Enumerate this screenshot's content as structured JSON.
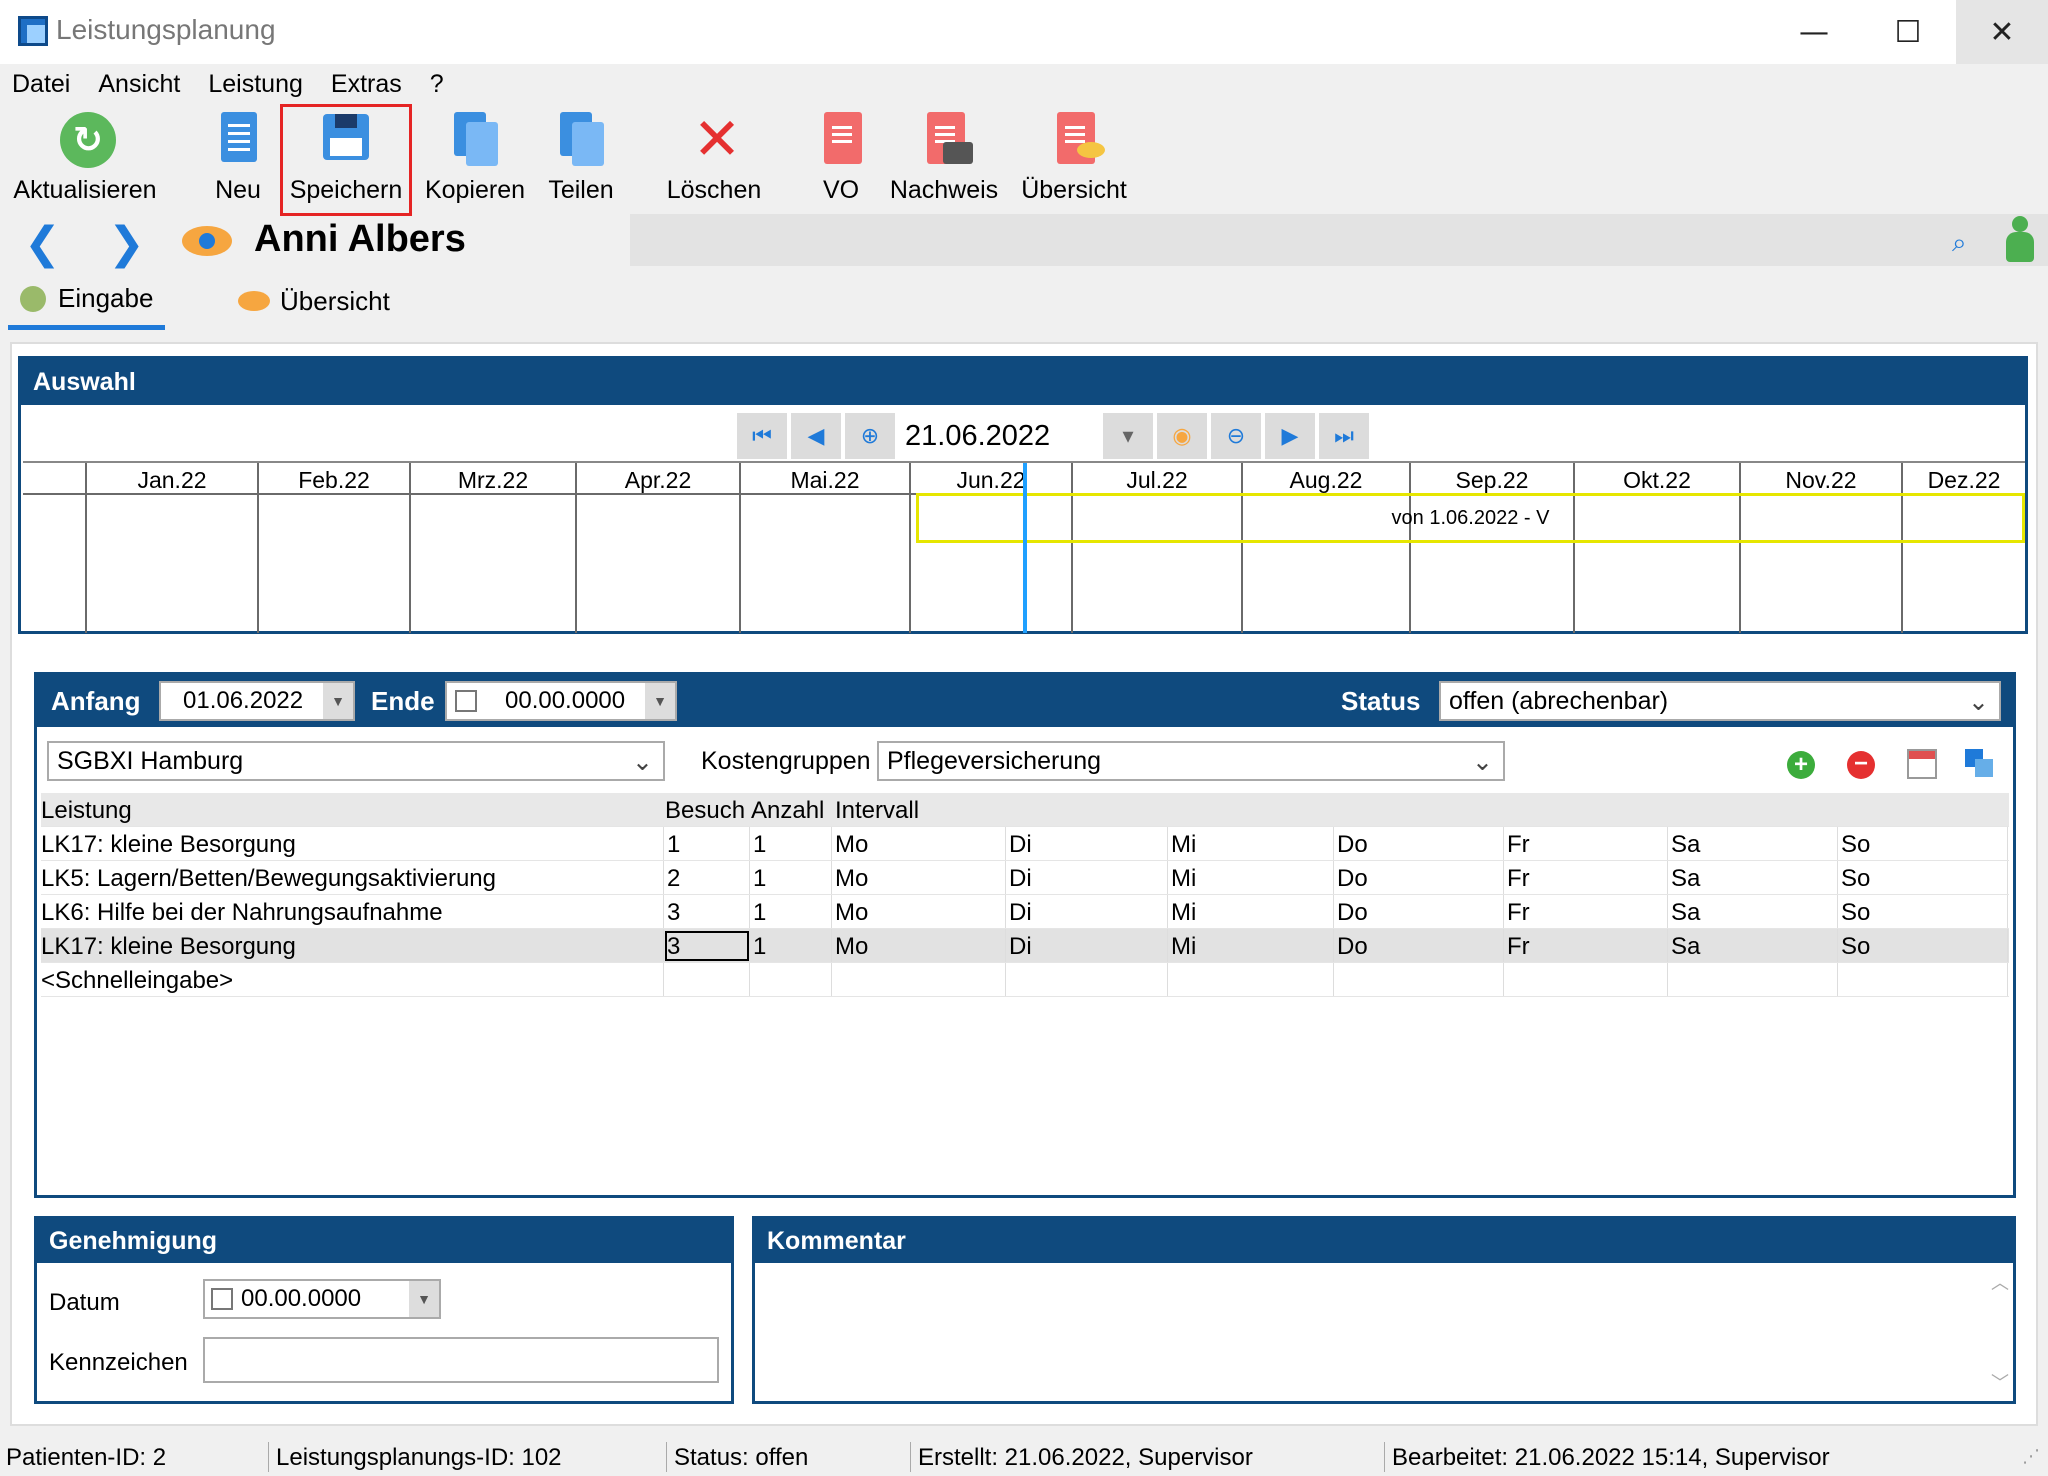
{
  "window": {
    "title": "Leistungsplanung",
    "minimize": "—",
    "maximize": "☐",
    "close": "✕"
  },
  "menu": [
    "Datei",
    "Ansicht",
    "Leistung",
    "Extras",
    "?"
  ],
  "toolbar": {
    "aktualisieren": "Aktualisieren",
    "neu": "Neu",
    "speichern": "Speichern",
    "kopieren": "Kopieren",
    "teilen": "Teilen",
    "loeschen": "Löschen",
    "vo": "VO",
    "nachweis": "Nachweis",
    "uebersicht": "Übersicht"
  },
  "patient": {
    "name": "Anni Albers"
  },
  "tabs": {
    "eingabe": "Eingabe",
    "uebersicht": "Übersicht"
  },
  "auswahl": {
    "title": "Auswahl",
    "date": "21.06.2022",
    "months": [
      "Jan.22",
      "Feb.22",
      "Mrz.22",
      "Apr.22",
      "Mai.22",
      "Jun.22",
      "Jul.22",
      "Aug.22",
      "Sep.22",
      "Okt.22",
      "Nov.22",
      "Dez.22"
    ],
    "bar_label": "von 1.06.2022 - V"
  },
  "detail": {
    "anfang_label": "Anfang",
    "anfang_value": "01.06.2022",
    "ende_label": "Ende",
    "ende_value": "00.00.0000",
    "status_label": "Status",
    "status_value": "offen (abrechenbar)",
    "katalog_value": "SGBXI Hamburg",
    "kostengruppen_label": "Kostengruppen",
    "kostengruppen_value": "Pflegeversicherung",
    "columns": {
      "leistung": "Leistung",
      "besuch": "Besuch",
      "anzahl": "Anzahl",
      "intervall": "Intervall"
    },
    "rows": [
      {
        "leistung": "LK17: kleine Besorgung",
        "besuch": "1",
        "anzahl": "1",
        "d": [
          "Mo",
          "Di",
          "Mi",
          "Do",
          "Fr",
          "Sa",
          "So"
        ]
      },
      {
        "leistung": "LK5: Lagern/Betten/Bewegungsaktivierung",
        "besuch": "2",
        "anzahl": "1",
        "d": [
          "Mo",
          "Di",
          "Mi",
          "Do",
          "Fr",
          "Sa",
          "So"
        ]
      },
      {
        "leistung": "LK6: Hilfe bei der Nahrungsaufnahme",
        "besuch": "3",
        "anzahl": "1",
        "d": [
          "Mo",
          "Di",
          "Mi",
          "Do",
          "Fr",
          "Sa",
          "So"
        ]
      },
      {
        "leistung": "LK17: kleine Besorgung",
        "besuch": "3",
        "anzahl": "1",
        "d": [
          "Mo",
          "Di",
          "Mi",
          "Do",
          "Fr",
          "Sa",
          "So"
        ]
      }
    ],
    "quick_entry": "<Schnelleingabe>"
  },
  "genehmigung": {
    "title": "Genehmigung",
    "datum_label": "Datum",
    "datum_value": "00.00.0000",
    "kennzeichen_label": "Kennzeichen",
    "kennzeichen_value": ""
  },
  "kommentar": {
    "title": "Kommentar"
  },
  "statusbar": {
    "patient_id": "Patienten-ID: 2",
    "plan_id": "Leistungsplanungs-ID: 102",
    "status": "Status: offen",
    "erstellt": "Erstellt: 21.06.2022, Supervisor",
    "bearbeitet": "Bearbeitet: 21.06.2022 15:14, Supervisor"
  },
  "colors": {
    "panel": "#0f4a7e",
    "accent": "#1f7ad9",
    "highlight": "#e52424",
    "timeline_bar": "#e6e600"
  }
}
